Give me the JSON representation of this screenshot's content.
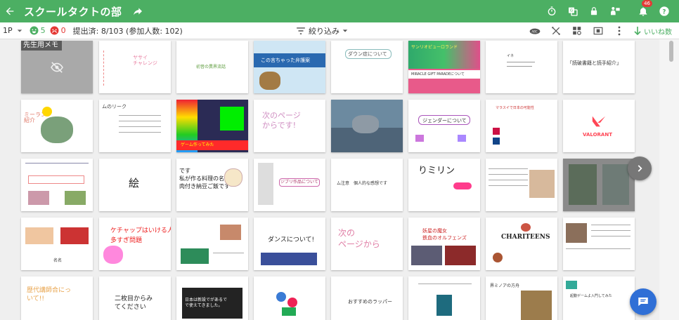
{
  "header": {
    "title": "スクールタクトの部",
    "notification_badge": "46"
  },
  "toolbar": {
    "page": "1P",
    "good_count": "5",
    "bad_count": "0",
    "submitted": "提出済: 8/103 (参加人数: 102)",
    "filter_label": "絞り込み",
    "likes_label": "いいね数"
  },
  "cards": [
    {
      "id": "teacher-memo",
      "label": "先生用メモ"
    },
    {
      "id": "r1c2",
      "text": "ヤサイ\nチャレンジ"
    },
    {
      "id": "r1c3",
      "text": "初音の異界流話"
    },
    {
      "id": "r1c4",
      "text": "この言ちゃった弁護案"
    },
    {
      "id": "r1c5",
      "text": "ダウン症について"
    },
    {
      "id": "r1c6",
      "text": "サンリオピューロランド",
      "text2": "MIRACLE GIFT PARADEについて"
    },
    {
      "id": "r1c7",
      "text": "イネ"
    },
    {
      "id": "r1c8",
      "text": "「読破書籍と読手紹介」"
    },
    {
      "id": "r2c1",
      "text": "ミーラン\n紹介"
    },
    {
      "id": "r2c2",
      "text": "ムのリーク"
    },
    {
      "id": "r2c3",
      "text": "ゲーム作ってみた"
    },
    {
      "id": "r2c4",
      "text": "次のページ\nからです!"
    },
    {
      "id": "r2c5",
      "text": ""
    },
    {
      "id": "r2c6",
      "text": "ジェンダーについて"
    },
    {
      "id": "r2c7",
      "text": "マラスイで日本の可能性"
    },
    {
      "id": "r2c8",
      "text": "VALORANT"
    },
    {
      "id": "r3c1",
      "text": ""
    },
    {
      "id": "r3c2",
      "text": "絵"
    },
    {
      "id": "r3c3",
      "text": "です\n私が作る料理の名は\n肉付き納豆ご飯です"
    },
    {
      "id": "r3c4",
      "text": "ジブリ作品について"
    },
    {
      "id": "r3c5",
      "text": "ム注意　個人的な感想です"
    },
    {
      "id": "r3c6",
      "text": "りミリン"
    },
    {
      "id": "r3c7",
      "text": ""
    },
    {
      "id": "r3c8",
      "text": ""
    },
    {
      "id": "r4c1",
      "text": "名名"
    },
    {
      "id": "r4c2",
      "text": "ケチャップはいける人\n多すぎ問題"
    },
    {
      "id": "r4c3",
      "text": ""
    },
    {
      "id": "r4c4",
      "text": "ダンスについて!"
    },
    {
      "id": "r4c5",
      "text": "次の\nページから"
    },
    {
      "id": "r4c6",
      "text": "妖星の魔女\n鉄血のオルフェンズ"
    },
    {
      "id": "r4c7",
      "text": "CHARITEENS"
    },
    {
      "id": "r4c8",
      "text": ""
    },
    {
      "id": "r5c1",
      "text": "歴代講師合にっ\nいて!!"
    },
    {
      "id": "r5c2",
      "text": "二枚目からみ\nてください"
    },
    {
      "id": "r5c3",
      "text": "日本は新設でがあるで\nで使えてきました。"
    },
    {
      "id": "r5c4",
      "text": ""
    },
    {
      "id": "r5c5",
      "text": "おすすめのラッパー"
    },
    {
      "id": "r5c6",
      "text": ""
    },
    {
      "id": "r5c7",
      "text": "界ミノアの方舟"
    },
    {
      "id": "r5c8",
      "text": "起動ゲームよ入門してみた"
    }
  ]
}
